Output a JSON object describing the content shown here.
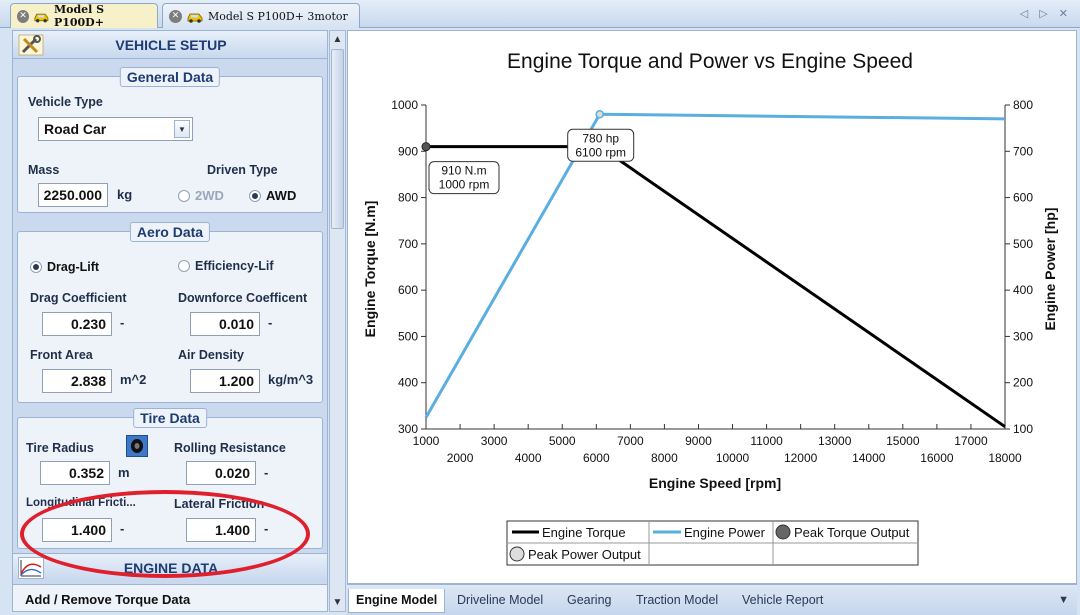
{
  "tabs": [
    {
      "label": "Model S P100D+",
      "active": true
    },
    {
      "label": "Model S P100D+ 3motor",
      "active": false
    }
  ],
  "tab_nav": "◁ ▷ ✕",
  "vehicle_setup": {
    "title": "VEHICLE SETUP",
    "general": {
      "title": "General Data",
      "vehicle_type_label": "Vehicle Type",
      "vehicle_type_value": "Road Car",
      "mass_label": "Mass",
      "mass_value": "2250.000",
      "mass_unit": "kg",
      "driven_type_label": "Driven Type",
      "drive_2wd": "2WD",
      "drive_awd": "AWD"
    },
    "aero": {
      "title": "Aero Data",
      "drag_lift": "Drag-Lift",
      "efficiency_lift": "Efficiency-Lif",
      "drag_coeff_label": "Drag Coefficient",
      "drag_coeff_value": "0.230",
      "drag_coeff_unit": "-",
      "downforce_label": "Downforce Coefficent",
      "downforce_value": "0.010",
      "downforce_unit": "-",
      "front_area_label": "Front Area",
      "front_area_value": "2.838",
      "front_area_unit": "m^2",
      "air_density_label": "Air Density",
      "air_density_value": "1.200",
      "air_density_unit": "kg/m^3"
    },
    "tire": {
      "title": "Tire Data",
      "radius_label": "Tire Radius",
      "radius_value": "0.352",
      "radius_unit": "m",
      "rolling_label": "Rolling Resistance",
      "rolling_value": "0.020",
      "rolling_unit": "-",
      "long_friction_label": "Longitudinal Fricti...",
      "long_friction_value": "1.400",
      "long_friction_unit": "-",
      "lat_friction_label": "Lateral Friction",
      "lat_friction_value": "1.400",
      "lat_friction_unit": "-"
    },
    "engine_title": "ENGINE DATA",
    "add_remove": "Add / Remove Torque Data"
  },
  "bottom_tabs": [
    "Engine Model",
    "Driveline Model",
    "Gearing",
    "Traction Model",
    "Vehicle Report"
  ],
  "chart_data": {
    "type": "line",
    "title": "Engine Torque and Power vs Engine Speed",
    "xlabel": "Engine Speed [rpm]",
    "ylabel": "Engine Torque [N.m]",
    "y2label": "Engine Power [hp]",
    "xlim": [
      1000,
      18000
    ],
    "ylim": [
      300,
      1000
    ],
    "y2lim": [
      100,
      800
    ],
    "x_ticks_top": [
      "1000",
      "3000",
      "5000",
      "7000",
      "9000",
      "11000",
      "13000",
      "15000",
      "17000"
    ],
    "x_ticks_bottom": [
      "2000",
      "4000",
      "6000",
      "8000",
      "10000",
      "12000",
      "14000",
      "16000",
      "18000"
    ],
    "y_ticks": [
      "300",
      "400",
      "500",
      "600",
      "700",
      "800",
      "900",
      "1000"
    ],
    "y2_ticks": [
      "100",
      "200",
      "300",
      "400",
      "500",
      "600",
      "700",
      "800"
    ],
    "series": [
      {
        "name": "Engine Torque",
        "axis": "left",
        "color": "#000000",
        "x": [
          1000,
          6100,
          18000
        ],
        "y": [
          910,
          910,
          305
        ]
      },
      {
        "name": "Engine Power",
        "axis": "right",
        "color": "#5aaee0",
        "x": [
          1000,
          6100,
          18000
        ],
        "y": [
          125,
          780,
          770
        ]
      }
    ],
    "peak_torque": {
      "name": "Peak Torque Output",
      "x": 1000,
      "y": 910,
      "label_1": "910 N.m",
      "label_2": "1000 rpm"
    },
    "peak_power": {
      "name": "Peak Power Output",
      "x": 6100,
      "y": 780,
      "label_1": "780 hp",
      "label_2": "6100 rpm"
    },
    "legend": [
      "Engine Torque",
      "Engine Power",
      "Peak Torque Output",
      "Peak Power Output"
    ],
    "legend_position": "bottom-center"
  }
}
